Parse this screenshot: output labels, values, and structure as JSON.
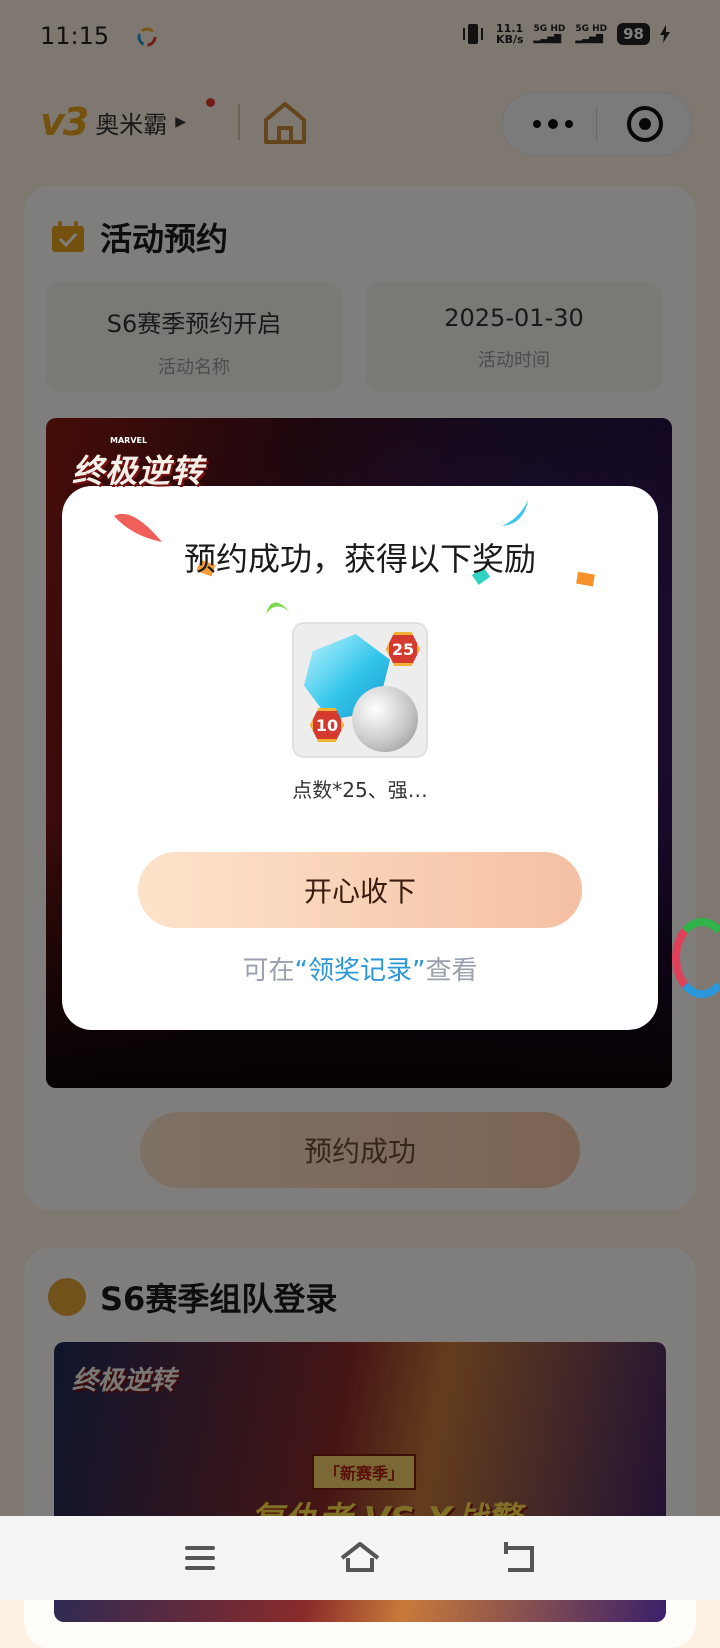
{
  "status_bar": {
    "time": "11:15",
    "speed_value": "11.1",
    "speed_unit": "KB/s",
    "net1": "5G HD",
    "net2": "5G HD",
    "battery": "98"
  },
  "header": {
    "brand_logo": "v3",
    "brand_name": "奥米霸",
    "home_icon": "home-icon",
    "capsule_more_icon": "more-dots-icon",
    "capsule_close_icon": "target-close-icon"
  },
  "activity_card": {
    "title": "活动预约",
    "name_value": "S6赛季预约开启",
    "name_label": "活动名称",
    "time_value": "2025-01-30",
    "time_label": "活动时间",
    "banner_logo": "终极逆转",
    "banner_logo_small": "MARVEL",
    "reserve_button": "预约成功"
  },
  "team_card": {
    "title": "S6赛季组队登录",
    "banner_logo": "终极逆转",
    "new_season": "「新赛季」",
    "vs_text": "复仇者 VS X战警"
  },
  "modal": {
    "title": "预约成功，获得以下奖励",
    "reward_badge_top": "25",
    "reward_badge_bottom": "10",
    "reward_label": "点数*25、强…",
    "accept_button": "开心收下",
    "record_prefix": "可在",
    "record_link": "“领奖记录”",
    "record_suffix": "查看"
  },
  "colors": {
    "accent_link": "#2b97d9",
    "button_gradient_start": "#fde3cb",
    "button_gradient_end": "#f5c0a3",
    "badge_red": "#d43a2e"
  },
  "navbar": {
    "menu_icon": "menu-icon",
    "home_icon": "home-icon",
    "back_icon": "back-icon"
  }
}
